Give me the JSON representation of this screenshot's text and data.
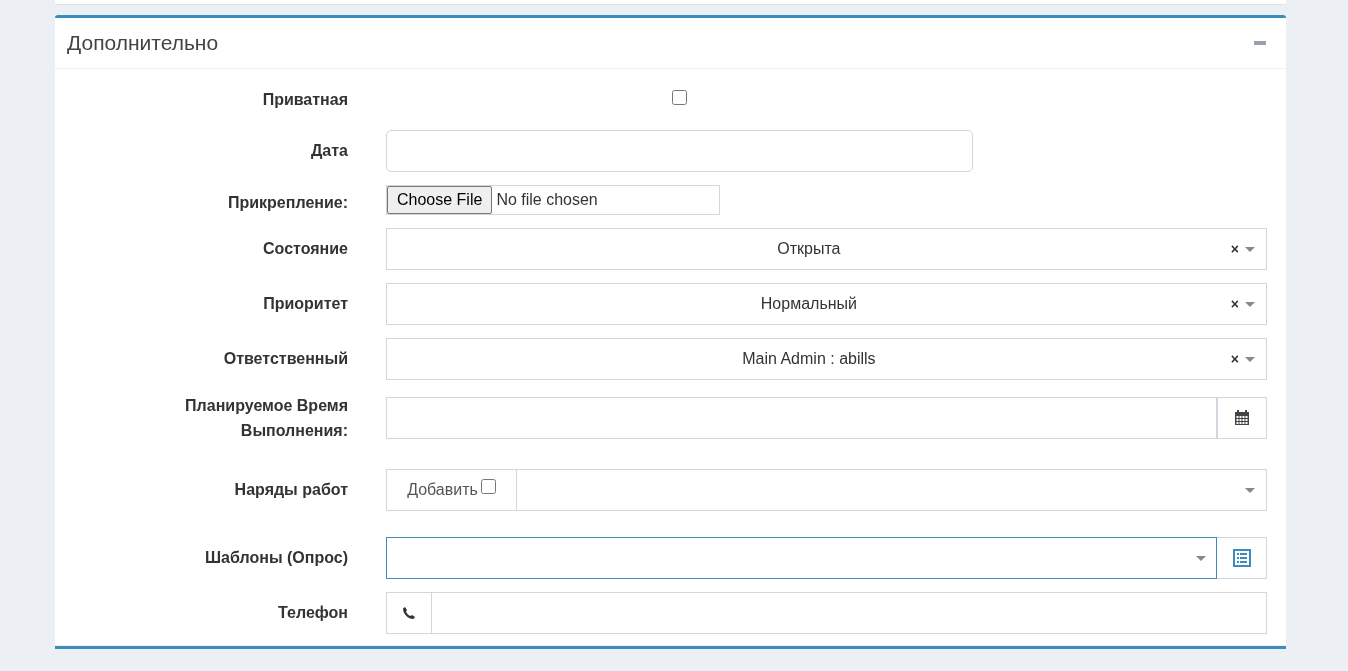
{
  "panel": {
    "title": "Дополнительно"
  },
  "fields": [
    {
      "kind": "checkbox",
      "label": "Приватная",
      "checked": false
    },
    {
      "kind": "text",
      "label": "Дата"
    },
    {
      "kind": "file",
      "label": "Прикрепление:",
      "button": "Choose File",
      "status": "No file chosen"
    },
    {
      "kind": "select",
      "label": "Состояние",
      "value": "Открыта",
      "clear": "×"
    },
    {
      "kind": "select",
      "label": "Приоритет",
      "value": "Нормальный",
      "clear": "×"
    },
    {
      "kind": "select",
      "label": "Ответственный",
      "value": "Main Admin : abills",
      "clear": "×"
    },
    {
      "kind": "datetime",
      "label": "Планируемое Время Выполнения:"
    },
    {
      "kind": "addon-select",
      "label": "Наряды работ",
      "addon": "Добавить",
      "checked": false
    },
    {
      "kind": "select-button",
      "label": "Шаблоны (Опрос)",
      "focused": true
    },
    {
      "kind": "phone",
      "label": "Телефон"
    }
  ]
}
